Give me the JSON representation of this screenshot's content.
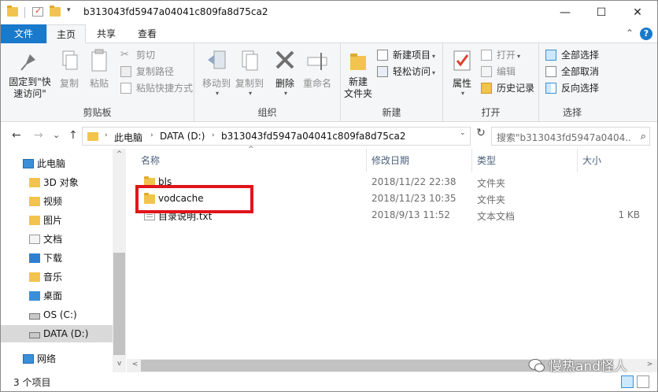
{
  "window": {
    "title": "b313043fd5947a04041c809fa8d75ca2",
    "minimize_glyph": "—",
    "maximize_glyph": "☐",
    "close_glyph": "✕"
  },
  "quick_access": {
    "dropdown_glyph": "▾"
  },
  "tabs": {
    "file": "文件",
    "home": "主页",
    "share": "共享",
    "view": "查看",
    "collapse_glyph": "⌃",
    "help_glyph": "?"
  },
  "ribbon": {
    "clipboard": {
      "label": "剪贴板",
      "pin": "固定到\"快\n速访问\"",
      "copy": "复制",
      "paste": "粘贴",
      "cut": "剪切",
      "copy_path": "复制路径",
      "paste_shortcut": "粘贴快捷方式"
    },
    "organize": {
      "label": "组织",
      "move_to": "移动到",
      "copy_to": "复制到",
      "delete": "删除",
      "rename": "重命名"
    },
    "new": {
      "label": "新建",
      "new_folder": "新建\n文件夹",
      "new_item": "新建项目",
      "easy_access": "轻松访问"
    },
    "open": {
      "label": "打开",
      "properties": "属性",
      "open": "打开",
      "edit": "编辑",
      "history": "历史记录"
    },
    "select": {
      "label": "选择",
      "select_all": "全部选择",
      "select_none": "全部取消",
      "invert": "反向选择"
    }
  },
  "address": {
    "back_glyph": "←",
    "forward_glyph": "→",
    "recent_glyph": "⌄",
    "up_glyph": "↑",
    "crumbs": [
      "此电脑",
      "DATA (D:)",
      "b313043fd5947a04041c809fa8d75ca2"
    ],
    "crumb_sep": "›",
    "dropdown_glyph": "⌄",
    "refresh_glyph": "↻",
    "search_placeholder": "搜索\"b313043fd5947a0404...",
    "search_glyph": "⌕"
  },
  "nav_pane": {
    "items": [
      {
        "label": "此电脑",
        "icon": "pc-icon"
      },
      {
        "label": "3D 对象",
        "icon": "3d-objects-icon"
      },
      {
        "label": "视频",
        "icon": "videos-icon"
      },
      {
        "label": "图片",
        "icon": "pictures-icon"
      },
      {
        "label": "文档",
        "icon": "documents-icon"
      },
      {
        "label": "下载",
        "icon": "downloads-icon"
      },
      {
        "label": "音乐",
        "icon": "music-icon"
      },
      {
        "label": "桌面",
        "icon": "desktop-icon"
      },
      {
        "label": "OS (C:)",
        "icon": "drive-icon"
      },
      {
        "label": "DATA (D:)",
        "icon": "drive-icon",
        "selected": true
      },
      {
        "label": "网络",
        "icon": "network-icon"
      }
    ]
  },
  "file_list": {
    "columns": {
      "name": "名称",
      "modified": "修改日期",
      "type": "类型",
      "size": "大小"
    },
    "sort_glyph": "^",
    "rows": [
      {
        "name": "bls",
        "modified": "2018/11/22 22:38",
        "type": "文件夹",
        "size": "",
        "icon": "folder-icon"
      },
      {
        "name": "vodcache",
        "modified": "2018/11/23 10:35",
        "type": "文件夹",
        "size": "",
        "icon": "folder-icon"
      },
      {
        "name": "目录说明.txt",
        "modified": "2018/9/13 11:52",
        "type": "文本文档",
        "size": "1 KB",
        "icon": "text-file-icon"
      }
    ],
    "highlight_color": "#e0151a"
  },
  "scroll": {
    "up_glyph": "^",
    "down_glyph": "v",
    "left_glyph": "<",
    "right_glyph": ">"
  },
  "status": {
    "item_count": "3 个项目"
  },
  "watermark": {
    "text": "慢热and怪人"
  },
  "colors": {
    "accent": "#1979ca",
    "folder": "#f2c44e",
    "selection": "#d9d9d9"
  }
}
